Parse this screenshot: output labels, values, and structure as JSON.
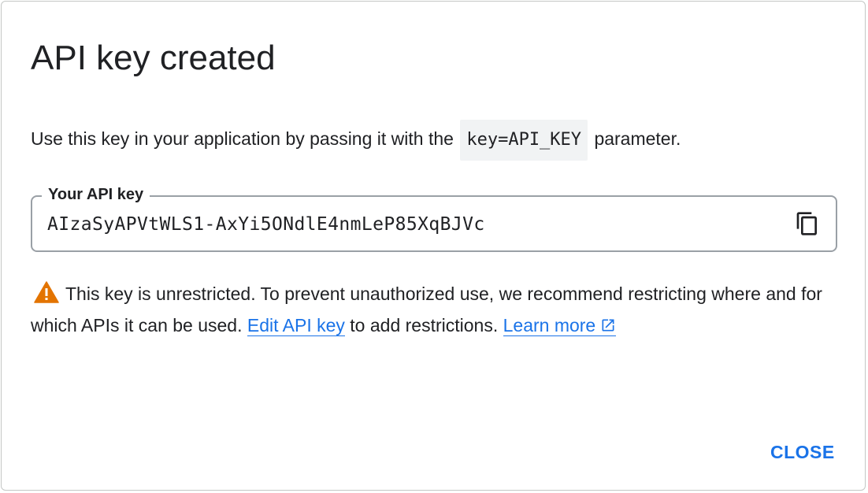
{
  "dialog": {
    "title": "API key created",
    "intro": {
      "before": "Use this key in your application by passing it with the",
      "code": "key=API_KEY",
      "after": "parameter."
    },
    "key_field": {
      "label": "Your API key",
      "value": "AIzaSyAPVtWLS1-AxYi5ONdlE4nmLeP85XqBJVc",
      "copy_icon": "copy-icon"
    },
    "warning": {
      "icon": "warning-icon",
      "text": "This key is unrestricted. To prevent unauthorized use, we recommend restricting where and for which APIs it can be used.",
      "edit_link": "Edit API key",
      "middle": "to add restrictions.",
      "learn_more": "Learn more",
      "external_icon": "external-link-icon",
      "warning_color": "#e37400",
      "link_color": "#1a73e8"
    },
    "close_label": "CLOSE"
  }
}
